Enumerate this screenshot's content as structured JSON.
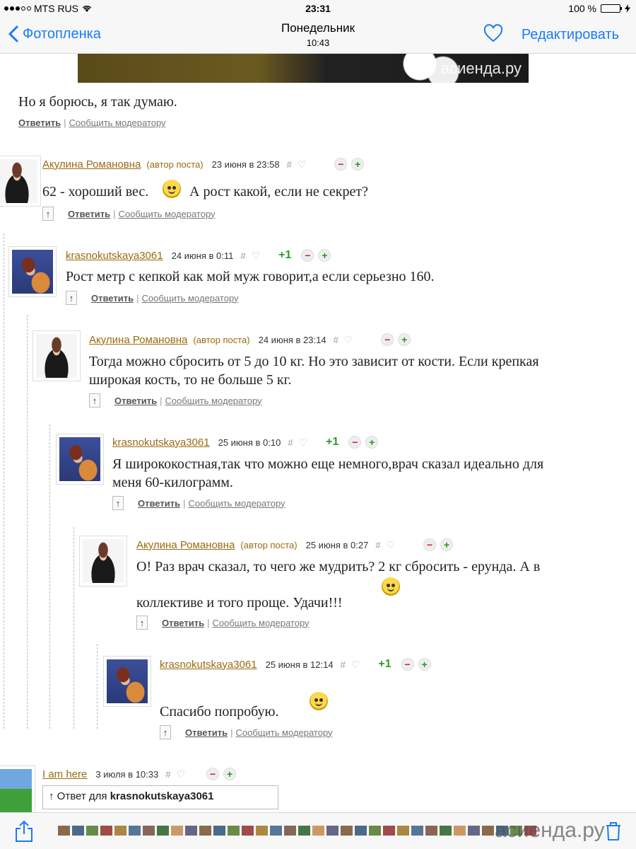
{
  "status_bar": {
    "carrier": "MTS RUS",
    "time": "23:31",
    "battery": "100 %",
    "battery_level": 1.0
  },
  "nav": {
    "back_label": "Фотопленка",
    "title": "Понедельник",
    "subtitle": "10:43",
    "edit_label": "Редактировать"
  },
  "watermark": "асиенда.ру",
  "top_text": "Но я борюсь, я так думаю.",
  "actions": {
    "reply": "Ответить",
    "report": "Сообщить модератору",
    "separator": "|"
  },
  "comments": [
    {
      "author": "Акулина Романовна",
      "author_tag": "(автор поста)",
      "date": "23 июня в 23:58",
      "score": "",
      "text": "62 - хороший вес.",
      "text_after": "А рост какой, если не секрет?"
    },
    {
      "author": "krasnokutskaya3061",
      "author_tag": "",
      "date": "24 июня в 0:11",
      "score": "+1",
      "text": "Рост метр с кепкой как мой муж говорит,а если серьезно 160."
    },
    {
      "author": "Акулина Романовна",
      "author_tag": "(автор поста)",
      "date": "24 июня в 23:14",
      "score": "",
      "text_line1": "Тогда можно сбросить от 5 до 10 кг. Но это зависит от кости. Если крепкая",
      "text_line2": "широкая кость, то не больше 5 кг."
    },
    {
      "author": "krasnokutskaya3061",
      "author_tag": "",
      "date": "25 июня в 0:10",
      "score": "+1",
      "text_line1": "Я ширококостная,так что можно еще немного,врач сказал идеально для",
      "text_line2": "меня 60-килограмм."
    },
    {
      "author": "Акулина Романовна",
      "author_tag": "(автор поста)",
      "date": "25 июня в 0:27",
      "score": "",
      "text_line1": "О! Раз врач сказал, то чего же мудрить? 2 кг сбросить - ерунда. А в",
      "text_line2": "коллективе и того проще. Удачи!!!"
    },
    {
      "author": "krasnokutskaya3061",
      "author_tag": "",
      "date": "25 июня в 12:14",
      "score": "+1",
      "text": "Спасибо попробую."
    },
    {
      "author": "I am here",
      "author_tag": "",
      "date": "3 июля в 10:33",
      "score": ""
    }
  ],
  "vote": {
    "minus": "−",
    "plus": "+"
  },
  "reply_box": {
    "prefix": "Ответ для",
    "target": "krasnokutskaya3061"
  },
  "icons": {
    "up": "↑",
    "hash": "#",
    "heart": "♡"
  },
  "colors": {
    "ios_blue": "#1a7cf5",
    "author": "#9a6b12",
    "score": "#2a9d2a",
    "minus": "#d32020",
    "plus": "#1e9a1e"
  }
}
